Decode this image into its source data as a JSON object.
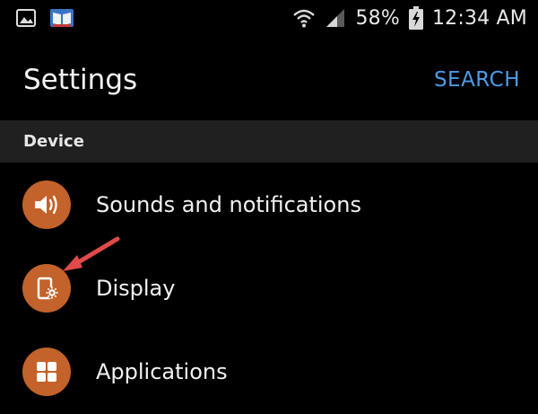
{
  "status_bar": {
    "left_icons": [
      "gallery-icon",
      "app-notification-icon"
    ],
    "right_icons": [
      "wifi-icon",
      "signal-icon",
      "battery-charging-icon"
    ],
    "battery_percent": "58%",
    "time": "12:34 AM"
  },
  "header": {
    "title": "Settings",
    "search_label": "SEARCH"
  },
  "section": {
    "label": "Device"
  },
  "items": [
    {
      "label": "Sounds and notifications",
      "icon": "speaker-icon"
    },
    {
      "label": "Display",
      "icon": "display-settings-icon"
    },
    {
      "label": "Applications",
      "icon": "apps-grid-icon"
    }
  ],
  "colors": {
    "accent": "#4d9ce8",
    "icon_bg": "#c3622a",
    "section_bg": "#202020",
    "arrow": "#e04a4a"
  }
}
